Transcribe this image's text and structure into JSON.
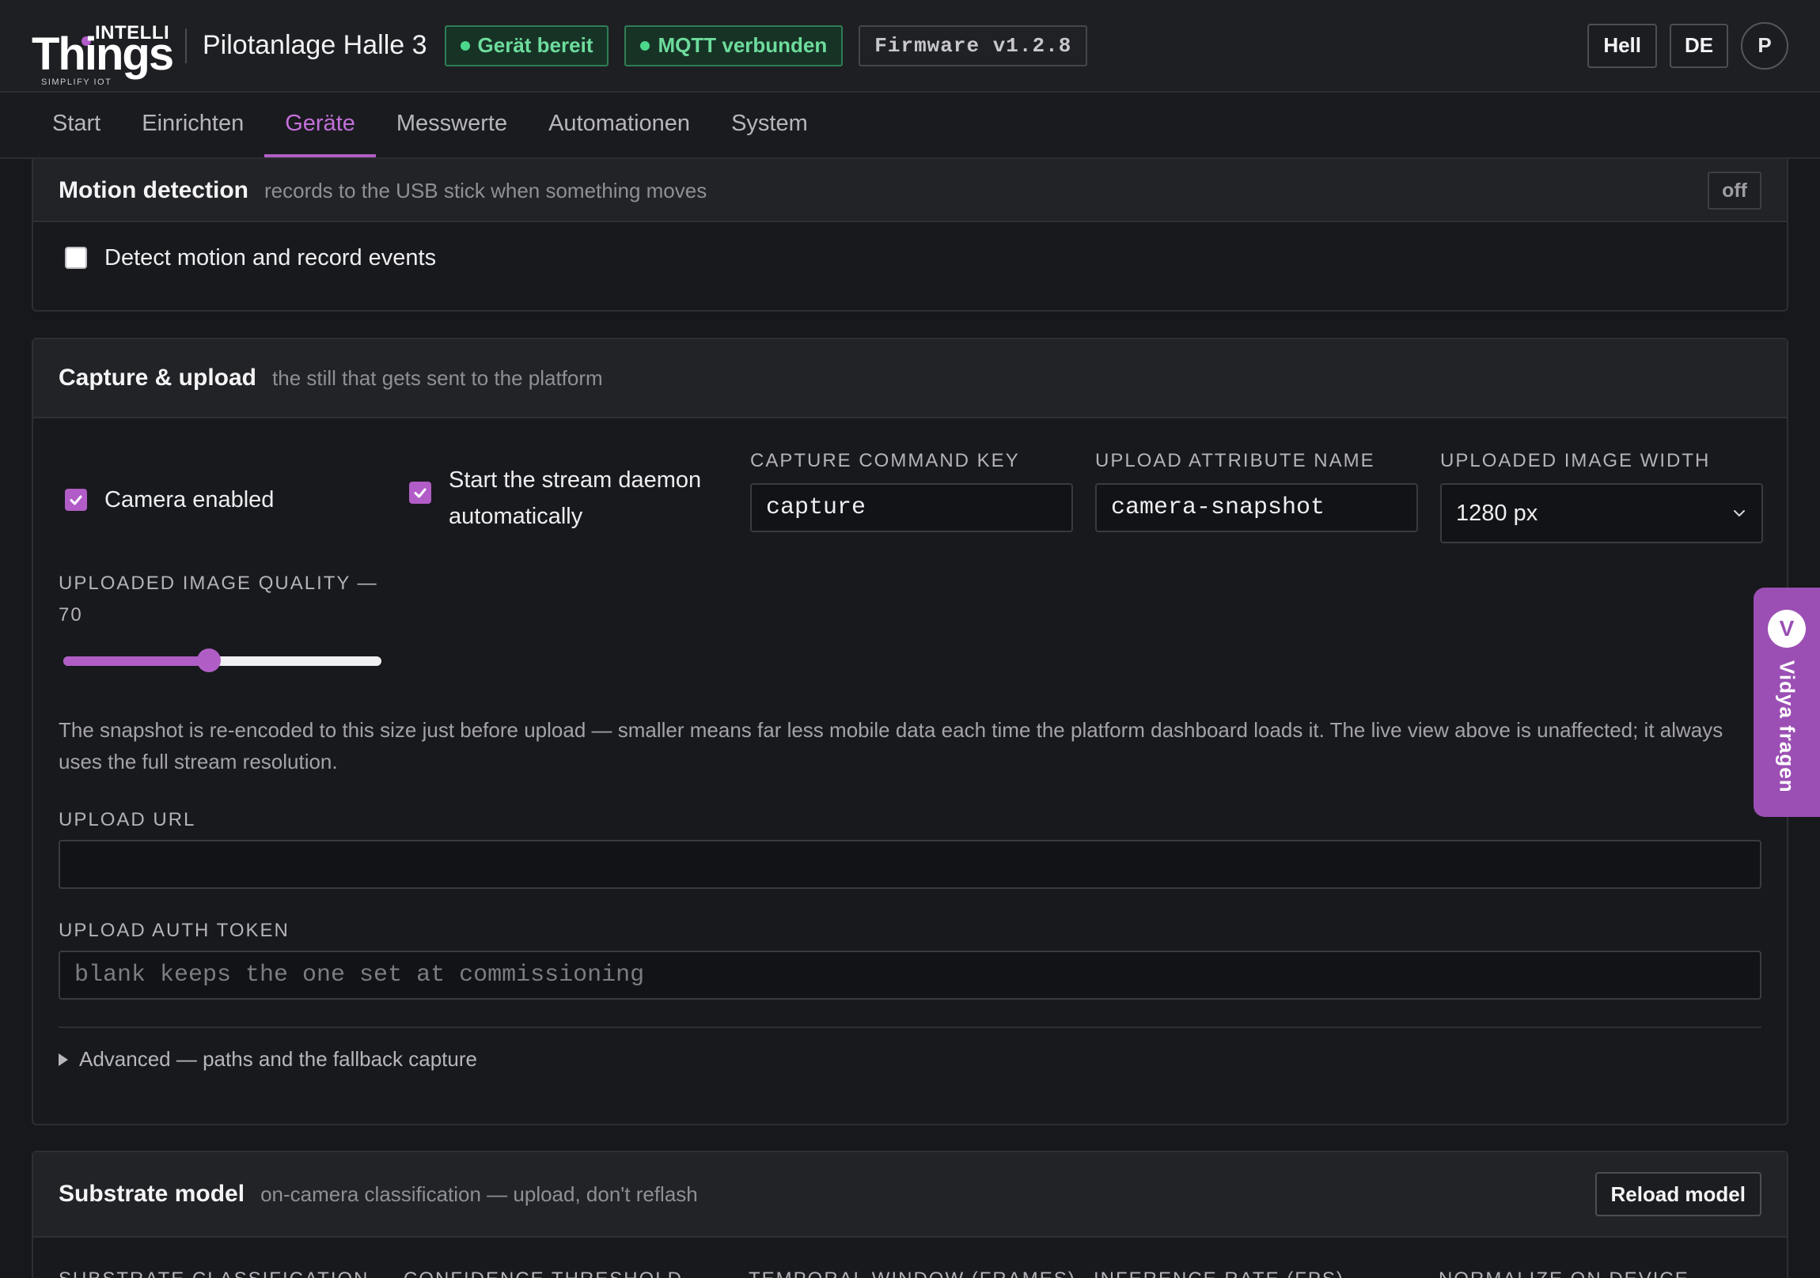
{
  "header": {
    "logo": {
      "brand_top": "INTELLI",
      "brand_main": "Things",
      "tagline": "SIMPLIFY IOT"
    },
    "site_title": "Pilotanlage Halle 3",
    "status_device": "Gerät bereit",
    "status_mqtt": "MQTT verbunden",
    "firmware": "Firmware v1.2.8",
    "theme_button": "Hell",
    "language_button": "DE",
    "avatar_initial": "P"
  },
  "nav": {
    "tabs": [
      {
        "label": "Start"
      },
      {
        "label": "Einrichten"
      },
      {
        "label": "Geräte"
      },
      {
        "label": "Messwerte"
      },
      {
        "label": "Automationen"
      },
      {
        "label": "System"
      }
    ],
    "active": "Geräte"
  },
  "motion": {
    "title": "Motion detection",
    "subtitle": "records to the USB stick when something moves",
    "state_badge": "off",
    "checkbox_label": "Detect motion and record events",
    "checked": false
  },
  "capture": {
    "title": "Capture & upload",
    "subtitle": "the still that gets sent to the platform",
    "camera_enabled_label": "Camera enabled",
    "camera_enabled": true,
    "stream_daemon_label": "Start the stream daemon automatically",
    "stream_daemon": true,
    "command_key_label": "CAPTURE COMMAND KEY",
    "command_key_value": "capture",
    "attribute_name_label": "UPLOAD ATTRIBUTE NAME",
    "attribute_name_value": "camera-snapshot",
    "image_width_label": "UPLOADED IMAGE WIDTH",
    "image_width_value": "1280 px",
    "quality_label": "UPLOADED IMAGE QUALITY —",
    "quality_value": "70",
    "quality_min": 0,
    "quality_max": 100,
    "help_text": "The snapshot is re-encoded to this size just before upload — smaller means far less mobile data each time the platform dashboard loads it. The live view above is unaffected; it always uses the full stream resolution.",
    "upload_url_label": "UPLOAD URL",
    "upload_url_value": "",
    "auth_token_label": "UPLOAD AUTH TOKEN",
    "auth_token_placeholder": "blank keeps the one set at commissioning",
    "advanced_label": "Advanced — paths and the fallback capture"
  },
  "substrate": {
    "title": "Substrate model",
    "subtitle": "on-camera classification — upload, don't reflash",
    "reload_button": "Reload model",
    "columns": [
      "SUBSTRATE CLASSIFICATION",
      "CONFIDENCE THRESHOLD",
      "TEMPORAL WINDOW (FRAMES)",
      "INFERENCE RATE (FPS)",
      "NORMALIZE ON DEVICE"
    ]
  },
  "assistant": {
    "badge": "V",
    "label": "Vidya fragen"
  },
  "colors": {
    "accent": "#b05ec6",
    "success": "#4bd88b",
    "background": "#17181b"
  }
}
